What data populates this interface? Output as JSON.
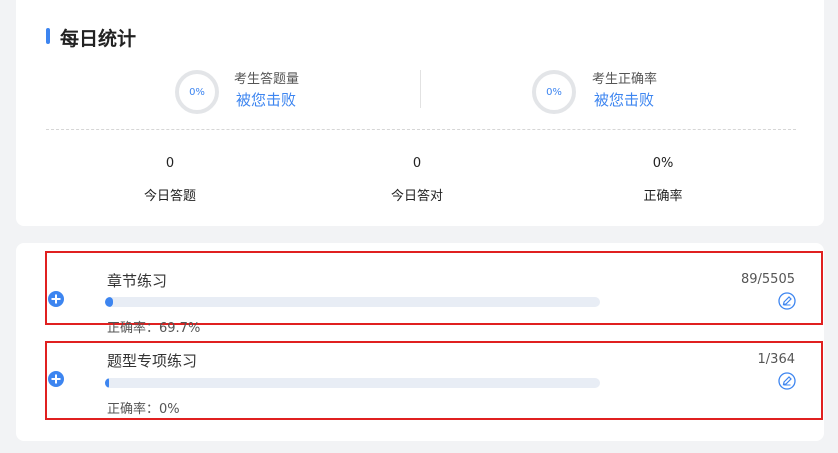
{
  "daily": {
    "title": "每日统计",
    "rings": [
      {
        "percent_text": "0%",
        "label": "考生答题量",
        "sub": "被您击败"
      },
      {
        "percent_text": "0%",
        "label": "考生正确率",
        "sub": "被您击败"
      }
    ],
    "stats": [
      {
        "value": "0",
        "label": "今日答题"
      },
      {
        "value": "0",
        "label": "今日答对"
      },
      {
        "value": "0%",
        "label": "正确率"
      }
    ]
  },
  "practice": {
    "items": [
      {
        "title": "章节练习",
        "count": "89/5505",
        "progress_fraction": 0.0162,
        "rate": "正确率：69.7%"
      },
      {
        "title": "题型专项练习",
        "count": "1/364",
        "progress_fraction": 0.0027,
        "rate": "正确率：0%"
      }
    ]
  },
  "colors": {
    "accent": "#3d85f0",
    "highlight": "#e02020"
  },
  "icons": {
    "add": "plus-circle-icon",
    "edit": "edit-circle-icon"
  }
}
